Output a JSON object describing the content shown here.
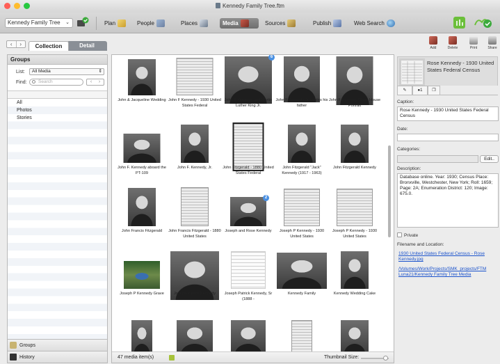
{
  "window": {
    "title": "Kennedy Family Tree.ftm"
  },
  "toolbar": {
    "tree_selector": "Kennedy Family Tree",
    "items": [
      {
        "label": "Plan",
        "icon": "plan-icon"
      },
      {
        "label": "People",
        "icon": "people-icon"
      },
      {
        "label": "Places",
        "icon": "places-icon"
      },
      {
        "label": "Media",
        "icon": "media-icon",
        "active": true
      },
      {
        "label": "Sources",
        "icon": "sources-icon"
      },
      {
        "label": "Publish",
        "icon": "publish-icon"
      },
      {
        "label": "Web Search",
        "icon": "web-search-icon"
      }
    ]
  },
  "tabs": {
    "collection": "Collection",
    "detail": "Detail"
  },
  "right_tools": {
    "add": "Add",
    "delete": "Delete",
    "print": "Print",
    "share": "Share"
  },
  "groups": {
    "title": "Groups",
    "list_label": "List:",
    "list_value": "All Media",
    "find_label": "Find:",
    "search_placeholder": "Search",
    "items": [
      "All",
      "Photos",
      "Stories"
    ],
    "footer_groups": "Groups",
    "footer_history": "History"
  },
  "media": {
    "items": [
      {
        "caption": "John & Jacqueline Wedding"
      },
      {
        "caption": "John F Kennedy - 1930 United States Federal"
      },
      {
        "caption": "John F Kennedy and Martin Luther King Jr.",
        "badge": "6"
      },
      {
        "caption": "John F Kennedy Jr salutes his father"
      },
      {
        "caption": "John F Kennedy White House Portrait"
      },
      {
        "caption": "John F. Kennedy aboard the PT-109"
      },
      {
        "caption": "John F. Kennedy, Jr."
      },
      {
        "caption": "John Fitzgerald - 1880 United States Federal"
      },
      {
        "caption": "John Fitzgerald \"Jack\" Kennedy (1917 - 1963)"
      },
      {
        "caption": "John Fitzgerald Kennedy"
      },
      {
        "caption": "John Francis Fitzgerald"
      },
      {
        "caption": "John Francis Fitzgerald - 1880 United States"
      },
      {
        "caption": "Joseph and Rose Kennedy",
        "badge": "2"
      },
      {
        "caption": "Joseph P Kennedy - 1930 United States"
      },
      {
        "caption": "Joseph P Kennedy - 1930 United States"
      },
      {
        "caption": "Joseph P Kennedy Grave"
      },
      {
        "caption": "Joseph Patrick Kennedy"
      },
      {
        "caption": "Joseph Patrick Kennedy, Sr (1888 -"
      },
      {
        "caption": "Kennedy Family"
      },
      {
        "caption": "Kennedy Wedding Cake"
      },
      {
        "caption": ""
      },
      {
        "caption": ""
      },
      {
        "caption": ""
      },
      {
        "caption": ""
      },
      {
        "caption": ""
      }
    ],
    "count_text": "47 media item(s)",
    "thumbnail_size_label": "Thumbnail Size:"
  },
  "detail": {
    "preview_title": "Rose Kennedy - 1930 United States Federal Census",
    "tab_count": "1",
    "caption_label": "Caption:",
    "caption_value": "Rose Kennedy - 1930 United States Federal Census",
    "date_label": "Date:",
    "date_value": "",
    "categories_label": "Categories:",
    "edit_button": "Edit..",
    "description_label": "Description:",
    "description_value": "Database online. Year: 1930; Census Place: Bronxville, Westchester, New York; Roll: 1659; Page: 2A; Enumeration District: 120; Image: 675.0.",
    "private_label": "Private",
    "filename_label": "Filename and Location:",
    "filename_link": "1930 United States Federal Census - Rose Kennedy.jpg",
    "path_link": "/Volumes/Work/Projects/SMK_projects/FTM Luna21/Kennedy Family Tree Media"
  },
  "colors": {
    "accent_blue": "#4a90e2",
    "link_blue": "#1a52cc",
    "active_tab": "#7a7a7a"
  }
}
